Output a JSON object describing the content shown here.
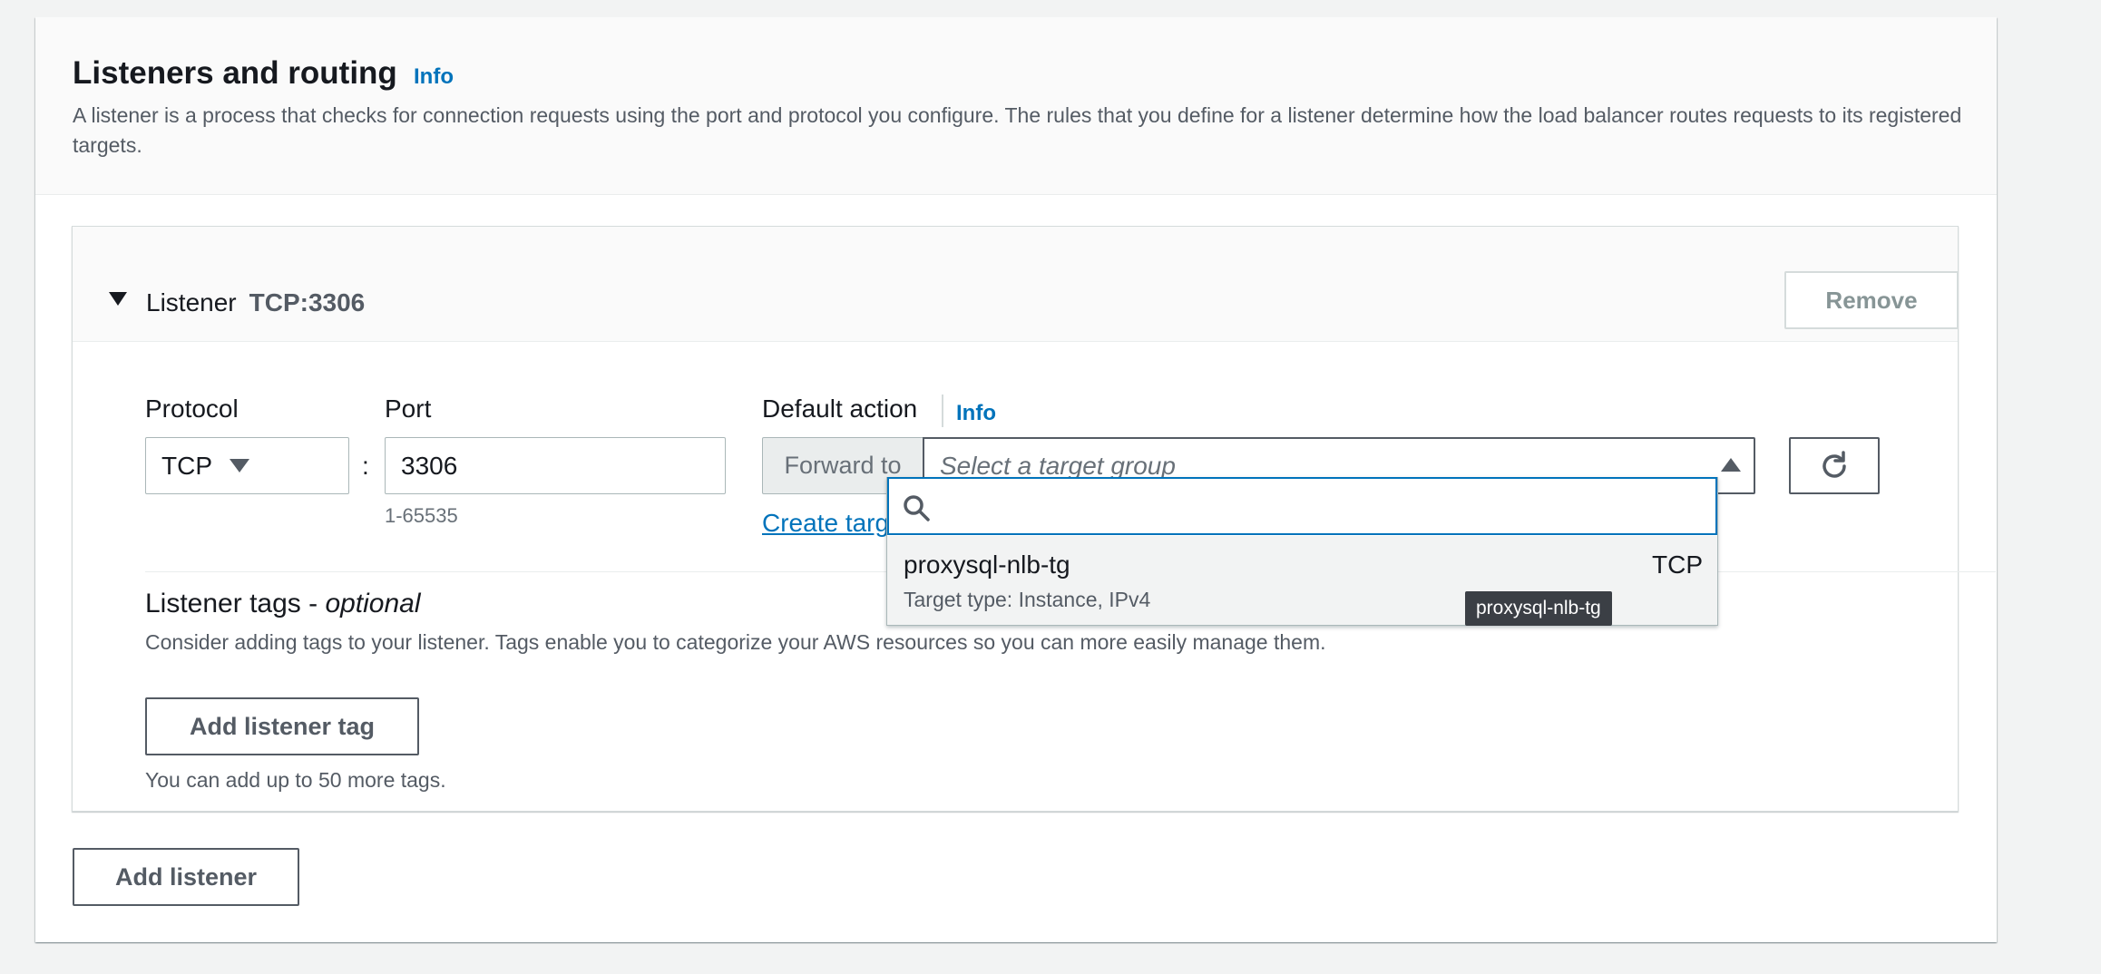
{
  "section": {
    "title": "Listeners and routing",
    "info_label": "Info",
    "description": "A listener is a process that checks for connection requests using the port and protocol you configure. The rules that you define for a listener determine how the load balancer routes requests to its registered targets."
  },
  "listener": {
    "label": "Listener",
    "name": "TCP:3306",
    "remove_label": "Remove",
    "protocol": {
      "label": "Protocol",
      "value": "TCP"
    },
    "colon": ":",
    "port": {
      "label": "Port",
      "value": "3306",
      "hint": "1-65535"
    },
    "default_action": {
      "label": "Default action",
      "info_label": "Info",
      "forward_label": "Forward to",
      "placeholder": "Select a target group",
      "create_link": "Create target"
    },
    "tags": {
      "title": "Listener tags - ",
      "title_suffix": "optional",
      "description": "Consider adding tags to your listener. Tags enable you to categorize your AWS resources so you can more easily manage them.",
      "add_label": "Add listener tag",
      "limit": "You can add up to 50 more tags."
    }
  },
  "add_listener_label": "Add listener",
  "dropdown": {
    "search_value": "",
    "options": [
      {
        "name": "proxysql-nlb-tg",
        "protocol": "TCP",
        "detail": "Target type: Instance, IPv4"
      }
    ],
    "tooltip": "proxysql-nlb-tg"
  },
  "icons": {
    "expand": "caret-down-icon",
    "select": "caret-down-icon",
    "dropdown_open": "caret-up-icon",
    "refresh": "refresh-icon",
    "search": "search-icon"
  },
  "colors": {
    "link": "#0073bb",
    "focus": "#0073bb",
    "text": "#16191f",
    "muted": "#545b64",
    "page_bg": "#f2f3f3"
  }
}
